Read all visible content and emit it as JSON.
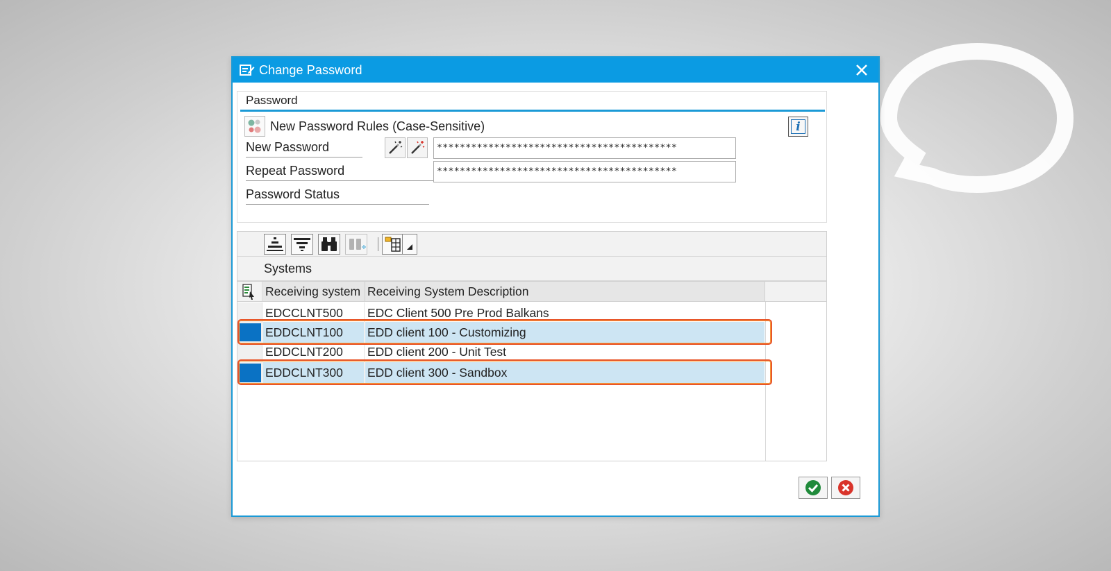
{
  "dialog": {
    "title": "Change Password",
    "close_icon": "close-icon"
  },
  "password_section": {
    "group_title": "Password",
    "rules_text": "New Password Rules (Case-Sensitive)",
    "info_icon": "i",
    "new_password_label": "New Password",
    "new_password_value": "******************************************",
    "repeat_password_label": "Repeat Password",
    "repeat_password_value": "******************************************",
    "status_label": "Password Status",
    "status_value": ""
  },
  "systems_section": {
    "title": "Systems",
    "columns": [
      "Receiving system",
      "Receiving System Description"
    ],
    "rows": [
      {
        "system": "EDCCLNT500",
        "description": "EDC Client 500 Pre Prod Balkans",
        "selected": false
      },
      {
        "system": "EDDCLNT100",
        "description": "EDD client 100 - Customizing",
        "selected": true
      },
      {
        "system": "EDDCLNT200",
        "description": "EDD client 200 - Unit Test",
        "selected": false
      },
      {
        "system": "EDDCLNT300",
        "description": "EDD client 300 - Sandbox",
        "selected": true
      }
    ]
  },
  "colors": {
    "title_bar": "#0b9be3",
    "selection": "#0a72c4",
    "row_highlight": "#cde5f3",
    "annotation_outline": "#e8562a"
  }
}
